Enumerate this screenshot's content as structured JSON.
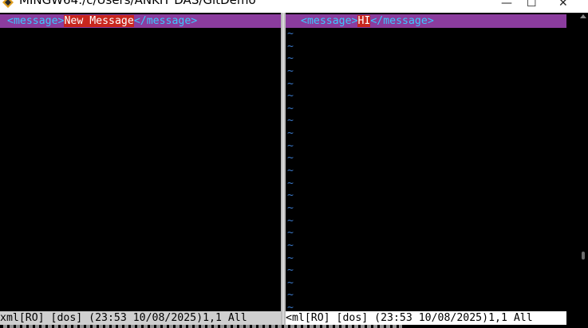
{
  "window": {
    "title": "MINGW64:/c/Users/ANKIT DAS/GitDemo",
    "controls": {
      "minimize": "—",
      "maximize": "☐",
      "close": "✕"
    }
  },
  "left_pane": {
    "line": {
      "open_tag": "<message>",
      "content": "New Message",
      "close_tag": "</message>"
    },
    "status": "xml[RO] [dos] (23:53 10/08/2025)1,1 All"
  },
  "right_pane": {
    "line": {
      "open_tag": "<message>",
      "content": "HI",
      "close_tag": "</message>"
    },
    "filler_char": "~",
    "status": "<ml[RO] [dos] (23:53 10/08/2025)1,1 All"
  },
  "colors": {
    "diff_line_bg": "#8b3c9e",
    "changed_text_bg": "#c8261e",
    "tag_color": "#3ec8ff",
    "tilde_color": "#3a78c9"
  }
}
